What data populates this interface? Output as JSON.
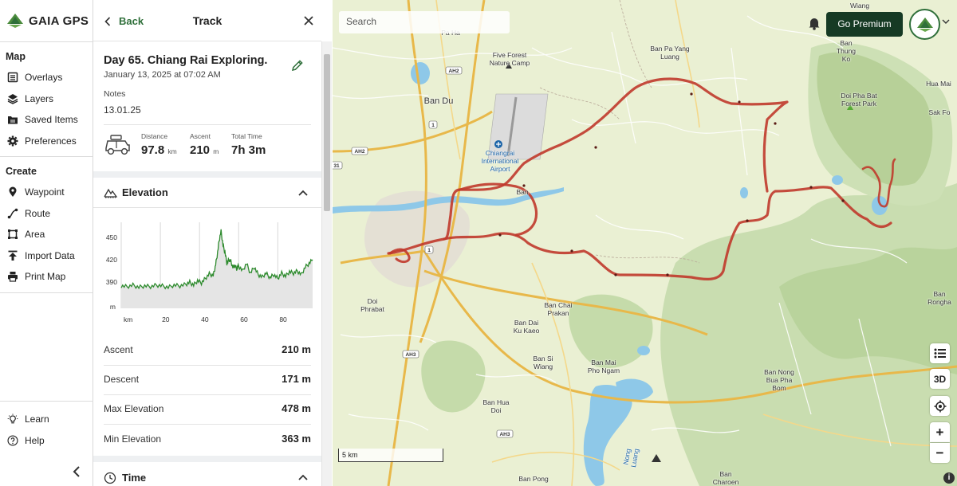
{
  "app": {
    "brand": "GAIA GPS"
  },
  "nav": {
    "map_section": "Map",
    "map_items": [
      {
        "label": "Overlays",
        "icon": "overlays-icon"
      },
      {
        "label": "Layers",
        "icon": "layers-icon"
      },
      {
        "label": "Saved Items",
        "icon": "saved-items-icon"
      },
      {
        "label": "Preferences",
        "icon": "gear-icon"
      }
    ],
    "create_section": "Create",
    "create_items": [
      {
        "label": "Waypoint",
        "icon": "pin-icon"
      },
      {
        "label": "Route",
        "icon": "route-icon"
      },
      {
        "label": "Area",
        "icon": "area-icon"
      },
      {
        "label": "Import Data",
        "icon": "upload-icon"
      },
      {
        "label": "Print Map",
        "icon": "printer-icon"
      }
    ],
    "bottom_items": [
      {
        "label": "Learn",
        "icon": "lightbulb-icon"
      },
      {
        "label": "Help",
        "icon": "help-icon"
      }
    ]
  },
  "panel": {
    "back_label": "Back",
    "title": "Track",
    "track_name": "Day 65. Chiang Rai Exploring.",
    "track_date": "January 13, 2025 at 07:02 AM",
    "notes_label": "Notes",
    "notes_value": "13.01.25",
    "stats": {
      "distance_label": "Distance",
      "distance_value": "97.8",
      "distance_unit": "km",
      "ascent_label": "Ascent",
      "ascent_value": "210",
      "ascent_unit": "m",
      "time_label": "Total Time",
      "time_value": "7h 3m"
    },
    "elevation_title": "Elevation",
    "time_title": "Time",
    "summary": [
      {
        "label": "Ascent",
        "value": "210 m"
      },
      {
        "label": "Descent",
        "value": "171 m"
      },
      {
        "label": "Max Elevation",
        "value": "478 m"
      },
      {
        "label": "Min Elevation",
        "value": "363 m"
      }
    ]
  },
  "chart_data": {
    "type": "area",
    "xlabel": "km",
    "ylabel": "m",
    "x_ticks": [
      "20",
      "40",
      "60",
      "80"
    ],
    "y_ticks": [
      "450",
      "420",
      "390"
    ],
    "xlim": [
      0,
      97.8
    ],
    "ylim": [
      355,
      470
    ],
    "series": [
      {
        "x": [
          0,
          3,
          6,
          9,
          12,
          15,
          18,
          21,
          24,
          27,
          30,
          33,
          35,
          37,
          39,
          41,
          43,
          45,
          47,
          48,
          49,
          50,
          51,
          52,
          53,
          54,
          55,
          56,
          57,
          58,
          59,
          60,
          62,
          64,
          66,
          68,
          70,
          72,
          74,
          76,
          78,
          80,
          82,
          84,
          86,
          88,
          90,
          92,
          94,
          96,
          97.8
        ],
        "y": [
          385,
          384,
          386,
          383,
          385,
          384,
          386,
          385,
          383,
          386,
          385,
          387,
          390,
          386,
          392,
          389,
          395,
          401,
          399,
          410,
          425,
          445,
          458,
          440,
          430,
          415,
          420,
          418,
          410,
          412,
          408,
          412,
          405,
          415,
          402,
          410,
          400,
          397,
          402,
          396,
          400,
          395,
          402,
          398,
          404,
          402,
          405,
          400,
          410,
          415,
          420
        ]
      }
    ]
  },
  "map": {
    "search_placeholder": "Search",
    "premium_label": "Go Premium",
    "scale_label": "5 km",
    "controls": [
      "list",
      "3D",
      "locate",
      "+",
      "−"
    ],
    "places": [
      "Ban Du",
      "Ban Pa Yang Luang",
      "Five Forest Nature Camp",
      "Chiangrai International Airport",
      "Ban Thung Ko",
      "Doi Pha Bat Forest Park",
      "Ban Rongha",
      "Ban Chai Prakan",
      "Ban Dai Ku Kaeo",
      "Ban Si Wiang",
      "Ban Mai Pho Ngam",
      "Ban Nong Bua Pha Bom",
      "Ban Hua Doi",
      "Ban Pong",
      "Ban Charoen",
      "Pa Ha",
      "Nong Luang",
      "Wiang",
      "Hua Mai",
      "Sak Fo",
      "Ban",
      "Doi Phrabat"
    ],
    "road_labels": [
      "AH2",
      "AH2",
      "AH3",
      "AH3",
      "1",
      "1",
      "31"
    ],
    "track_color": "#c0392b"
  }
}
